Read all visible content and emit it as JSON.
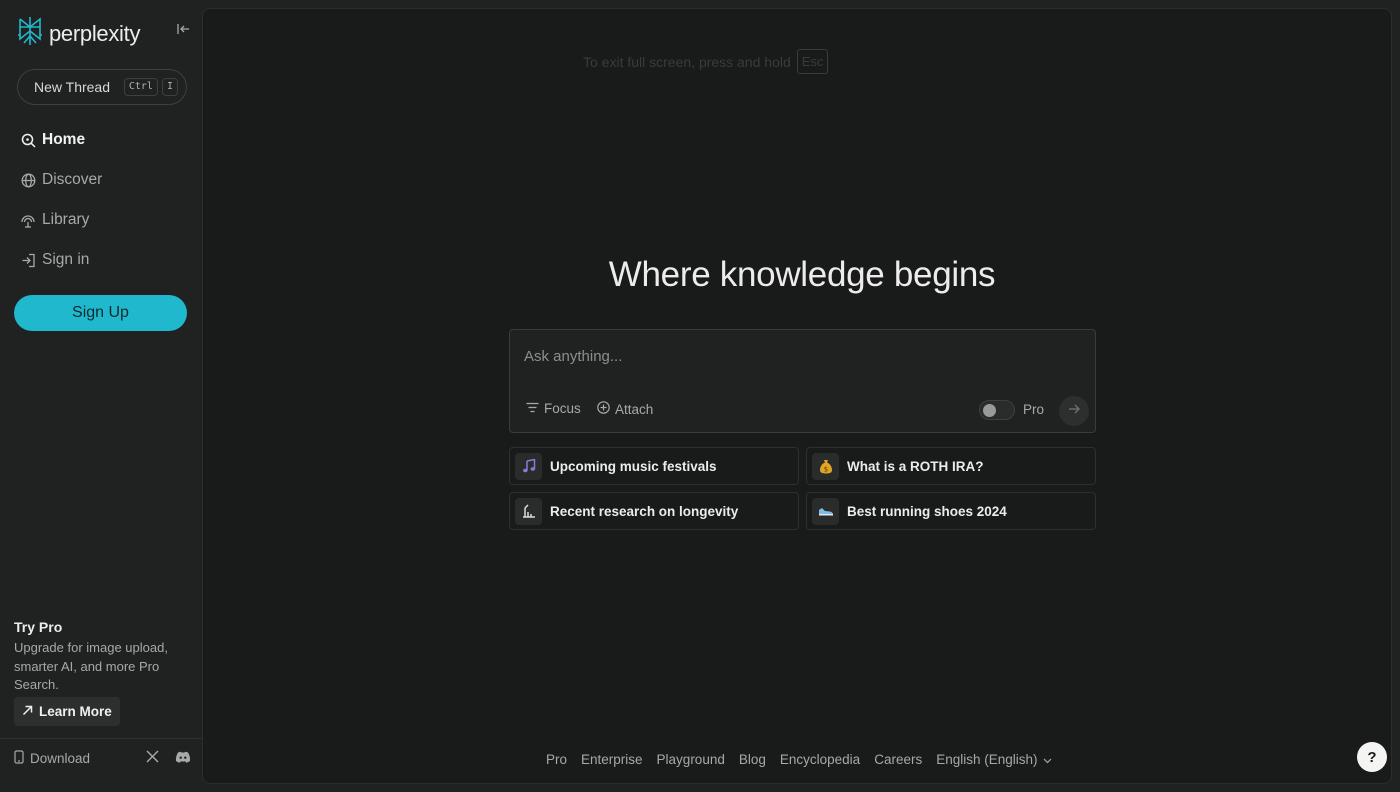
{
  "brand": {
    "name": "perplexity",
    "accent": "#20b8cd"
  },
  "sidebar": {
    "new_thread": {
      "label": "New Thread",
      "shortcut": [
        "Ctrl",
        "I"
      ]
    },
    "nav": [
      {
        "label": "Home",
        "icon": "search-icon",
        "active": true
      },
      {
        "label": "Discover",
        "icon": "globe-icon",
        "active": false
      },
      {
        "label": "Library",
        "icon": "library-icon",
        "active": false
      },
      {
        "label": "Sign in",
        "icon": "sign-in-icon",
        "active": false
      }
    ],
    "signup_label": "Sign Up",
    "try_pro": {
      "title": "Try Pro",
      "description": "Upgrade for image upload, smarter AI, and more Pro Search.",
      "learn_more": "Learn More"
    },
    "download_label": "Download"
  },
  "main": {
    "fullscreen_notice": "To exit full screen, press and hold",
    "fullscreen_key": "Esc",
    "headline": "Where knowledge begins",
    "ask": {
      "placeholder": "Ask anything...",
      "value": "",
      "focus_label": "Focus",
      "attach_label": "Attach",
      "pro_label": "Pro",
      "pro_enabled": false
    },
    "suggestions": [
      {
        "label": "Upcoming music festivals",
        "icon": "music-note-icon"
      },
      {
        "label": "What is a ROTH IRA?",
        "icon": "money-bag-icon"
      },
      {
        "label": "Recent research on longevity",
        "icon": "chart-icon"
      },
      {
        "label": "Best running shoes 2024",
        "icon": "running-shoe-icon"
      }
    ],
    "footer": [
      "Pro",
      "Enterprise",
      "Playground",
      "Blog",
      "Encyclopedia",
      "Careers",
      "English (English)"
    ],
    "help_label": "?"
  }
}
